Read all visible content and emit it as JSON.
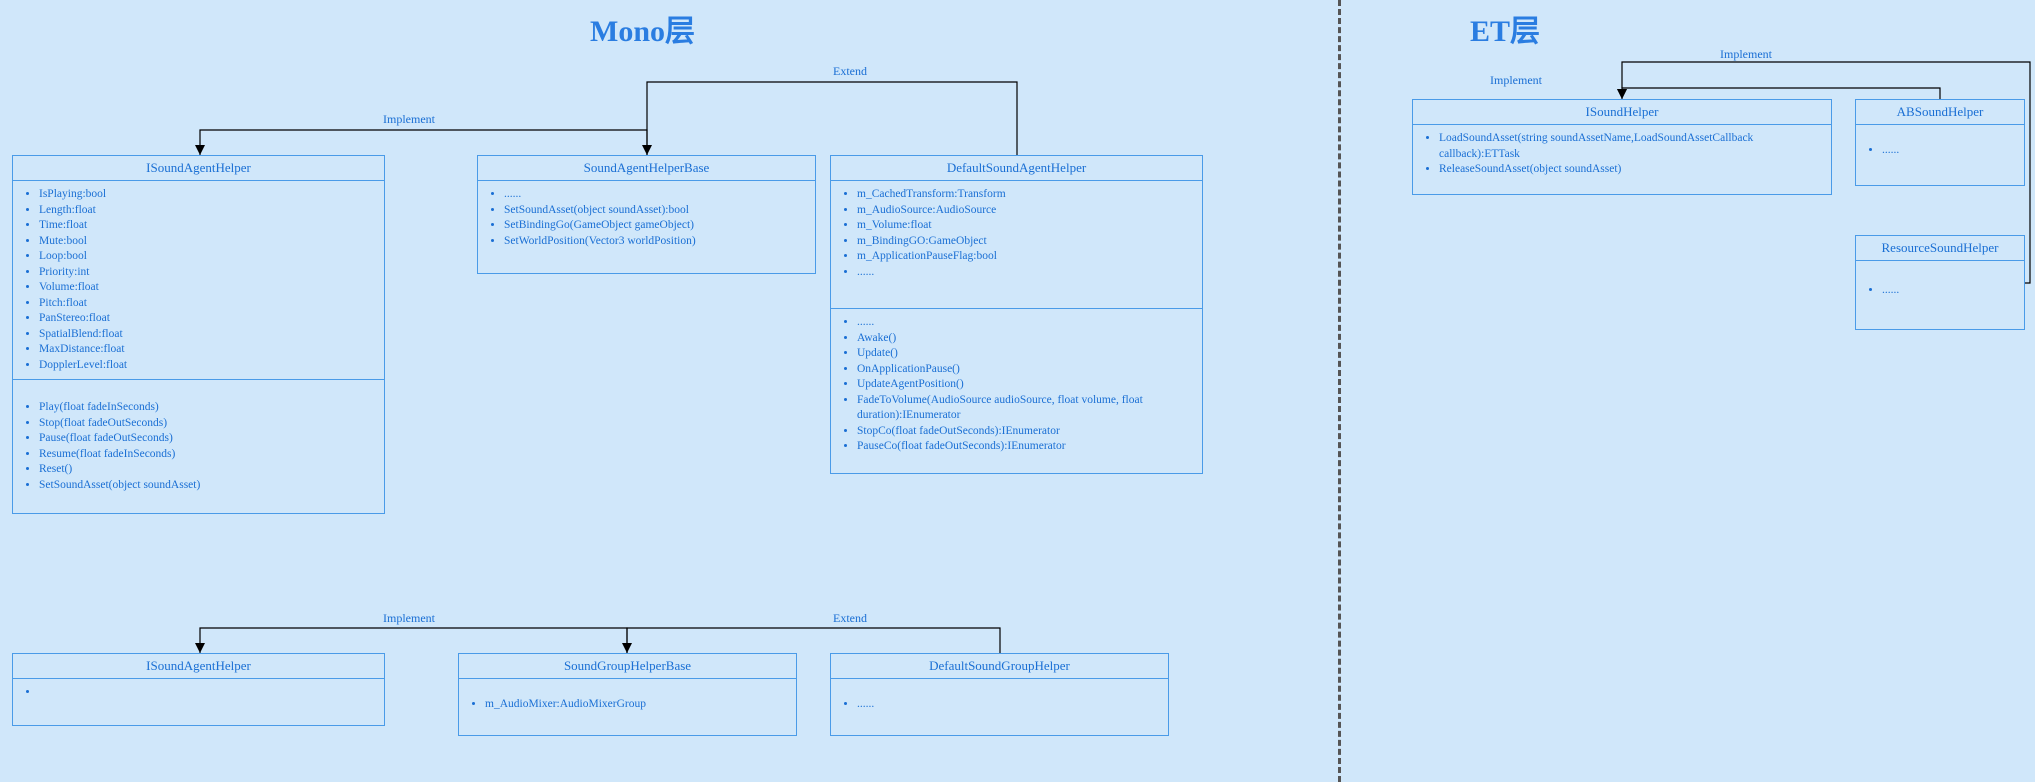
{
  "sections": {
    "mono": "Mono层",
    "et": "ET层"
  },
  "edges": {
    "implement": "Implement",
    "extend": "Extend"
  },
  "classes": {
    "isoundagenthelper1": {
      "title": "ISoundAgentHelper",
      "props": [
        "IsPlaying:bool",
        "Length:float",
        "Time:float",
        "Mute:bool",
        "Loop:bool",
        "Priority:int",
        "Volume:float",
        "Pitch:float",
        "PanStereo:float",
        "SpatialBlend:float",
        "MaxDistance:float",
        "DopplerLevel:float"
      ],
      "methods": [
        "Play(float fadeInSeconds)",
        "Stop(float fadeOutSeconds)",
        "Pause(float fadeOutSeconds)",
        "Resume(float fadeInSeconds)",
        "Reset()",
        "SetSoundAsset(object soundAsset)"
      ]
    },
    "soundagenthelperbase": {
      "title": "SoundAgentHelperBase",
      "items": [
        "......",
        "SetSoundAsset(object soundAsset):bool",
        "SetBindingGo(GameObject gameObject)",
        "SetWorldPosition(Vector3 worldPosition)"
      ]
    },
    "defaultsoundagenthelper": {
      "title": "DefaultSoundAgentHelper",
      "props": [
        "m_CachedTransform:Transform",
        "m_AudioSource:AudioSource",
        "m_Volume:float",
        "m_BindingGO:GameObject",
        "m_ApplicationPauseFlag:bool",
        "......"
      ],
      "methods": [
        "......",
        "Awake()",
        "Update()",
        "OnApplicationPause()",
        "UpdateAgentPosition()",
        "FadeToVolume(AudioSource audioSource, float volume, float duration):IEnumerator",
        "StopCo(float fadeOutSeconds):IEnumerator",
        "PauseCo(float fadeOutSeconds):IEnumerator"
      ]
    },
    "isoundagenthelper2": {
      "title": "ISoundAgentHelper",
      "items": [
        ""
      ]
    },
    "soundgrouphelperbase": {
      "title": "SoundGroupHelperBase",
      "items": [
        "m_AudioMixer:AudioMixerGroup"
      ]
    },
    "defaultsoundgrouphelper": {
      "title": "DefaultSoundGroupHelper",
      "items": [
        "......"
      ]
    },
    "isoundhelper": {
      "title": "ISoundHelper",
      "items": [
        "LoadSoundAsset(string soundAssetName,LoadSoundAssetCallback callback):ETTask",
        "ReleaseSoundAsset(object soundAsset)"
      ]
    },
    "absoundhelper": {
      "title": "ABSoundHelper",
      "items": [
        "......"
      ]
    },
    "resourcesoundhelper": {
      "title": "ResourceSoundHelper",
      "items": [
        "......"
      ]
    }
  }
}
